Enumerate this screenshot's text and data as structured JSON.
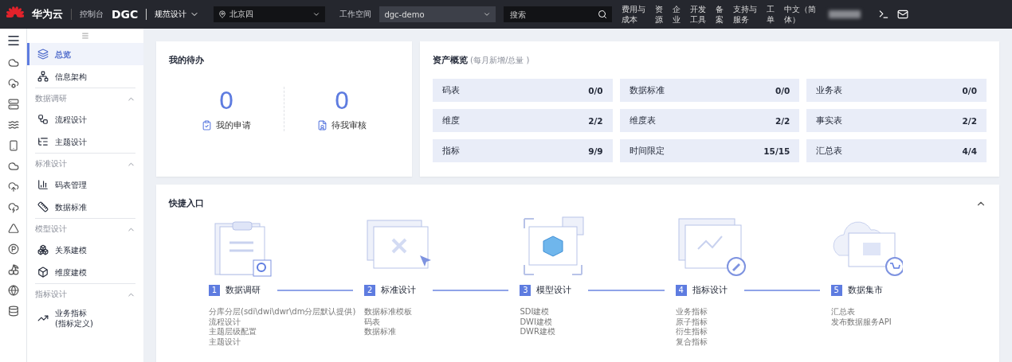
{
  "topbar": {
    "brand": "华为云",
    "console": "控制台",
    "product": "DGC",
    "module": "规范设计",
    "region": "北京四",
    "workspace_label": "工作空间",
    "workspace": "dgc-demo",
    "search": {
      "placeholder": "搜索"
    },
    "nav": [
      {
        "lines": [
          "费用与",
          "成本"
        ]
      },
      {
        "lines": [
          "资",
          "源"
        ]
      },
      {
        "lines": [
          "企",
          "业"
        ]
      },
      {
        "lines": [
          "开发",
          "工具"
        ]
      },
      {
        "lines": [
          "备",
          "案"
        ]
      },
      {
        "lines": [
          "支持与",
          "服务"
        ]
      },
      {
        "lines": [
          "工",
          "单"
        ]
      },
      {
        "lines": [
          "中文（简",
          "体）"
        ]
      }
    ]
  },
  "sidebar": {
    "items": [
      {
        "kind": "item",
        "label": "总览",
        "selected": true
      },
      {
        "kind": "item",
        "label": "信息架构",
        "selected": false
      },
      {
        "kind": "group",
        "label": "数据调研",
        "expanded": true
      },
      {
        "kind": "item",
        "label": "流程设计",
        "selected": false
      },
      {
        "kind": "item",
        "label": "主题设计",
        "selected": false
      },
      {
        "kind": "group",
        "label": "标准设计",
        "expanded": true
      },
      {
        "kind": "item",
        "label": "码表管理",
        "selected": false
      },
      {
        "kind": "item",
        "label": "数据标准",
        "selected": false
      },
      {
        "kind": "group",
        "label": "模型设计",
        "expanded": true
      },
      {
        "kind": "item",
        "label": "关系建模",
        "selected": false
      },
      {
        "kind": "item",
        "label": "维度建模",
        "selected": false
      },
      {
        "kind": "group",
        "label": "指标设计",
        "expanded": true
      },
      {
        "kind": "item",
        "label": "业务指标\n(指标定义)",
        "selected": false
      }
    ]
  },
  "todo": {
    "title": "我的待办",
    "stats": [
      {
        "value": "0",
        "label": "我的申请"
      },
      {
        "value": "0",
        "label": "待我审核"
      }
    ]
  },
  "assets": {
    "title": "资产概览",
    "subtitle": "(每月新增/总量 )",
    "cells": [
      {
        "label": "码表",
        "value": "0/0"
      },
      {
        "label": "数据标准",
        "value": "0/0"
      },
      {
        "label": "业务表",
        "value": "0/0"
      },
      {
        "label": "维度",
        "value": "2/2"
      },
      {
        "label": "维度表",
        "value": "2/2"
      },
      {
        "label": "事实表",
        "value": "2/2"
      },
      {
        "label": "指标",
        "value": "9/9"
      },
      {
        "label": "时间限定",
        "value": "15/15"
      },
      {
        "label": "汇总表",
        "value": "4/4"
      }
    ]
  },
  "quick": {
    "title": "快捷入口",
    "expanded": true,
    "steps": [
      {
        "number": "1",
        "title": "数据调研",
        "items": [
          "分库分层(sdi\\dwi\\dwr\\dm分层默认提供)",
          "流程设计",
          "主题层级配置",
          "主题设计"
        ]
      },
      {
        "number": "2",
        "title": "标准设计",
        "items": [
          "数据标准模板",
          "码表",
          "数据标准"
        ]
      },
      {
        "number": "3",
        "title": "模型设计",
        "items": [
          "SDI建模",
          "DWI建模",
          "DWR建模"
        ]
      },
      {
        "number": "4",
        "title": "指标设计",
        "items": [
          "业务指标",
          "原子指标",
          "衍生指标",
          "复合指标"
        ]
      },
      {
        "number": "5",
        "title": "数据集市",
        "items": [
          "汇总表",
          "发布数据服务API"
        ]
      }
    ]
  }
}
